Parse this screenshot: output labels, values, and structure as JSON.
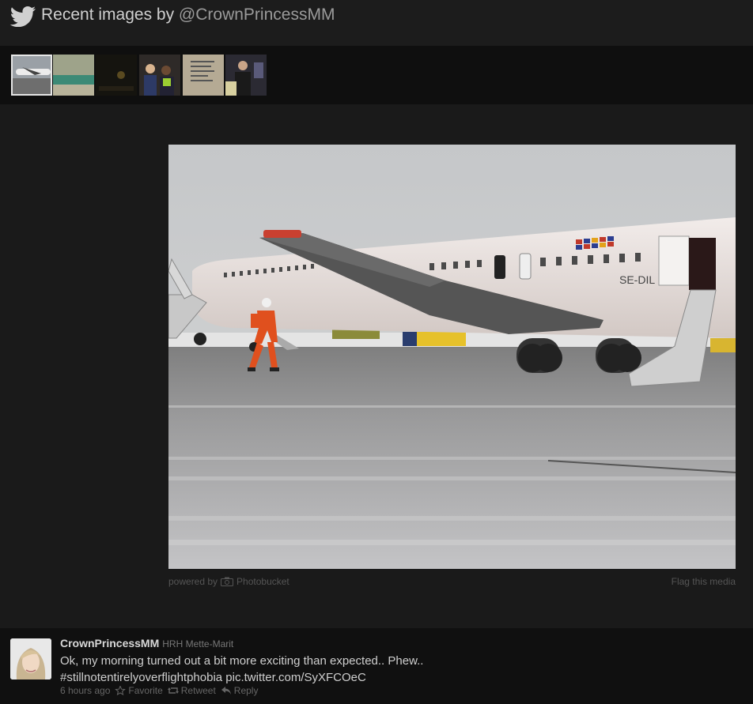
{
  "header": {
    "title_prefix": "Recent images by ",
    "handle": "@CrownPrincessMM",
    "icon": "twitter-bird-icon"
  },
  "thumbnails": [
    {
      "name": "thumb-airplane",
      "selected": true
    },
    {
      "name": "thumb-green-room",
      "selected": false
    },
    {
      "name": "thumb-dark-night",
      "selected": false
    },
    {
      "name": "thumb-group-photo",
      "selected": false
    },
    {
      "name": "thumb-quote-sign",
      "selected": false
    },
    {
      "name": "thumb-event-stage",
      "selected": false
    }
  ],
  "media": {
    "powered_by": "powered by",
    "provider": "Photobucket",
    "flag": "Flag this media",
    "plane_reg": "SE-DIL"
  },
  "tweet": {
    "username": "CrownPrincessMM",
    "real_name": "HRH Mette-Marit",
    "text_line1": "Ok, my morning turned out a bit more exciting than expected.. Phew..",
    "hashtag": "#stillnotentirelyoverflightphobia",
    "pic_link": "pic.twitter.com/SyXFCOeC",
    "time": "6 hours ago",
    "favorite": "Favorite",
    "retweet": "Retweet",
    "reply": "Reply"
  },
  "colors": {
    "background": "#1a1a1a",
    "header": "#1c1c1c",
    "strip": "#0f0f0f",
    "tweet_bg": "#101010"
  }
}
